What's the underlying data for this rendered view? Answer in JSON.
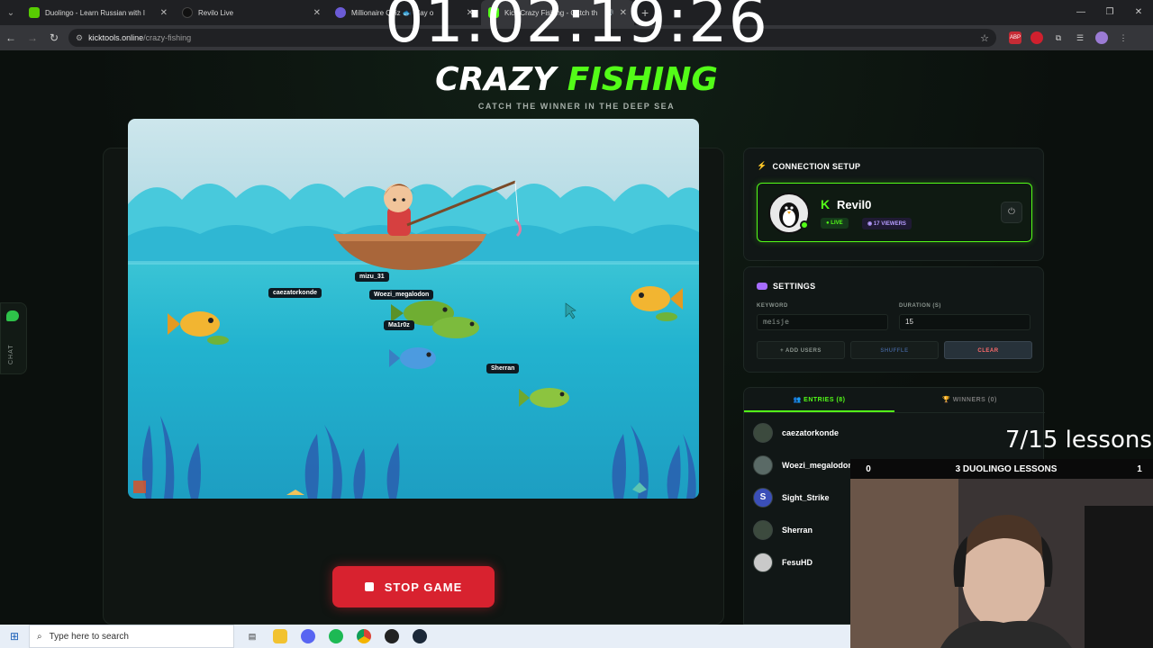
{
  "browser": {
    "tabs": [
      {
        "title": "Duolingo - Learn Russian with l",
        "color": "#58cc02",
        "active": false
      },
      {
        "title": "Revilo Live",
        "color": "#1f2023",
        "active": false
      },
      {
        "title": "Millionaire Quiz 🐟 Play o",
        "color": "#6b5bd6",
        "active": false
      },
      {
        "title": "Kick Crazy Fishing - Catch th",
        "color": "#53fc18",
        "active": true
      }
    ],
    "url_domain": "kicktools.online",
    "url_path": "/crazy-fishing"
  },
  "overlay": {
    "timer": "01:02:19:26",
    "lessons": "7/15 lessons",
    "lesson_bar": {
      "left": "0",
      "title": "3 DUOLINGO LESSONS",
      "right": "1"
    }
  },
  "header": {
    "logo_white": "CRAZY ",
    "logo_green": "FISHING",
    "tagline": "CATCH THE WINNER IN THE DEEP SEA"
  },
  "chat": {
    "label": "CHAT"
  },
  "game": {
    "labels": [
      "mizu_31",
      "caezatorkonde",
      "Woezi_megalodon",
      "Ma1r0z",
      "Sherran"
    ],
    "stop_label": "STOP GAME"
  },
  "connection": {
    "title": "CONNECTION SETUP",
    "channel": "Revil0",
    "live_label": "LIVE",
    "viewers_label": "17 VIEWERS"
  },
  "settings": {
    "title": "SETTINGS",
    "keyword_label": "KEYWORD",
    "keyword_value": "meisje",
    "duration_label": "DURATION (S)",
    "duration_value": "15",
    "add_users": "+ ADD USERS",
    "shuffle": "SHUFFLE",
    "clear": "CLEAR"
  },
  "entries": {
    "entries_tab": "ENTRIES (8)",
    "winners_tab": "WINNERS (0)",
    "items": [
      {
        "name": "caezatorkonde",
        "color": "#3c4a3e"
      },
      {
        "name": "Woezi_megalodon",
        "color": "#5a6a66"
      },
      {
        "name": "Sight_Strike",
        "color": "#3b4fb8"
      },
      {
        "name": "Sherran",
        "color": "#3c4a3e"
      },
      {
        "name": "FesuHD",
        "color": "#c9c9c9"
      }
    ]
  },
  "taskbar": {
    "search_placeholder": "Type here to search"
  }
}
